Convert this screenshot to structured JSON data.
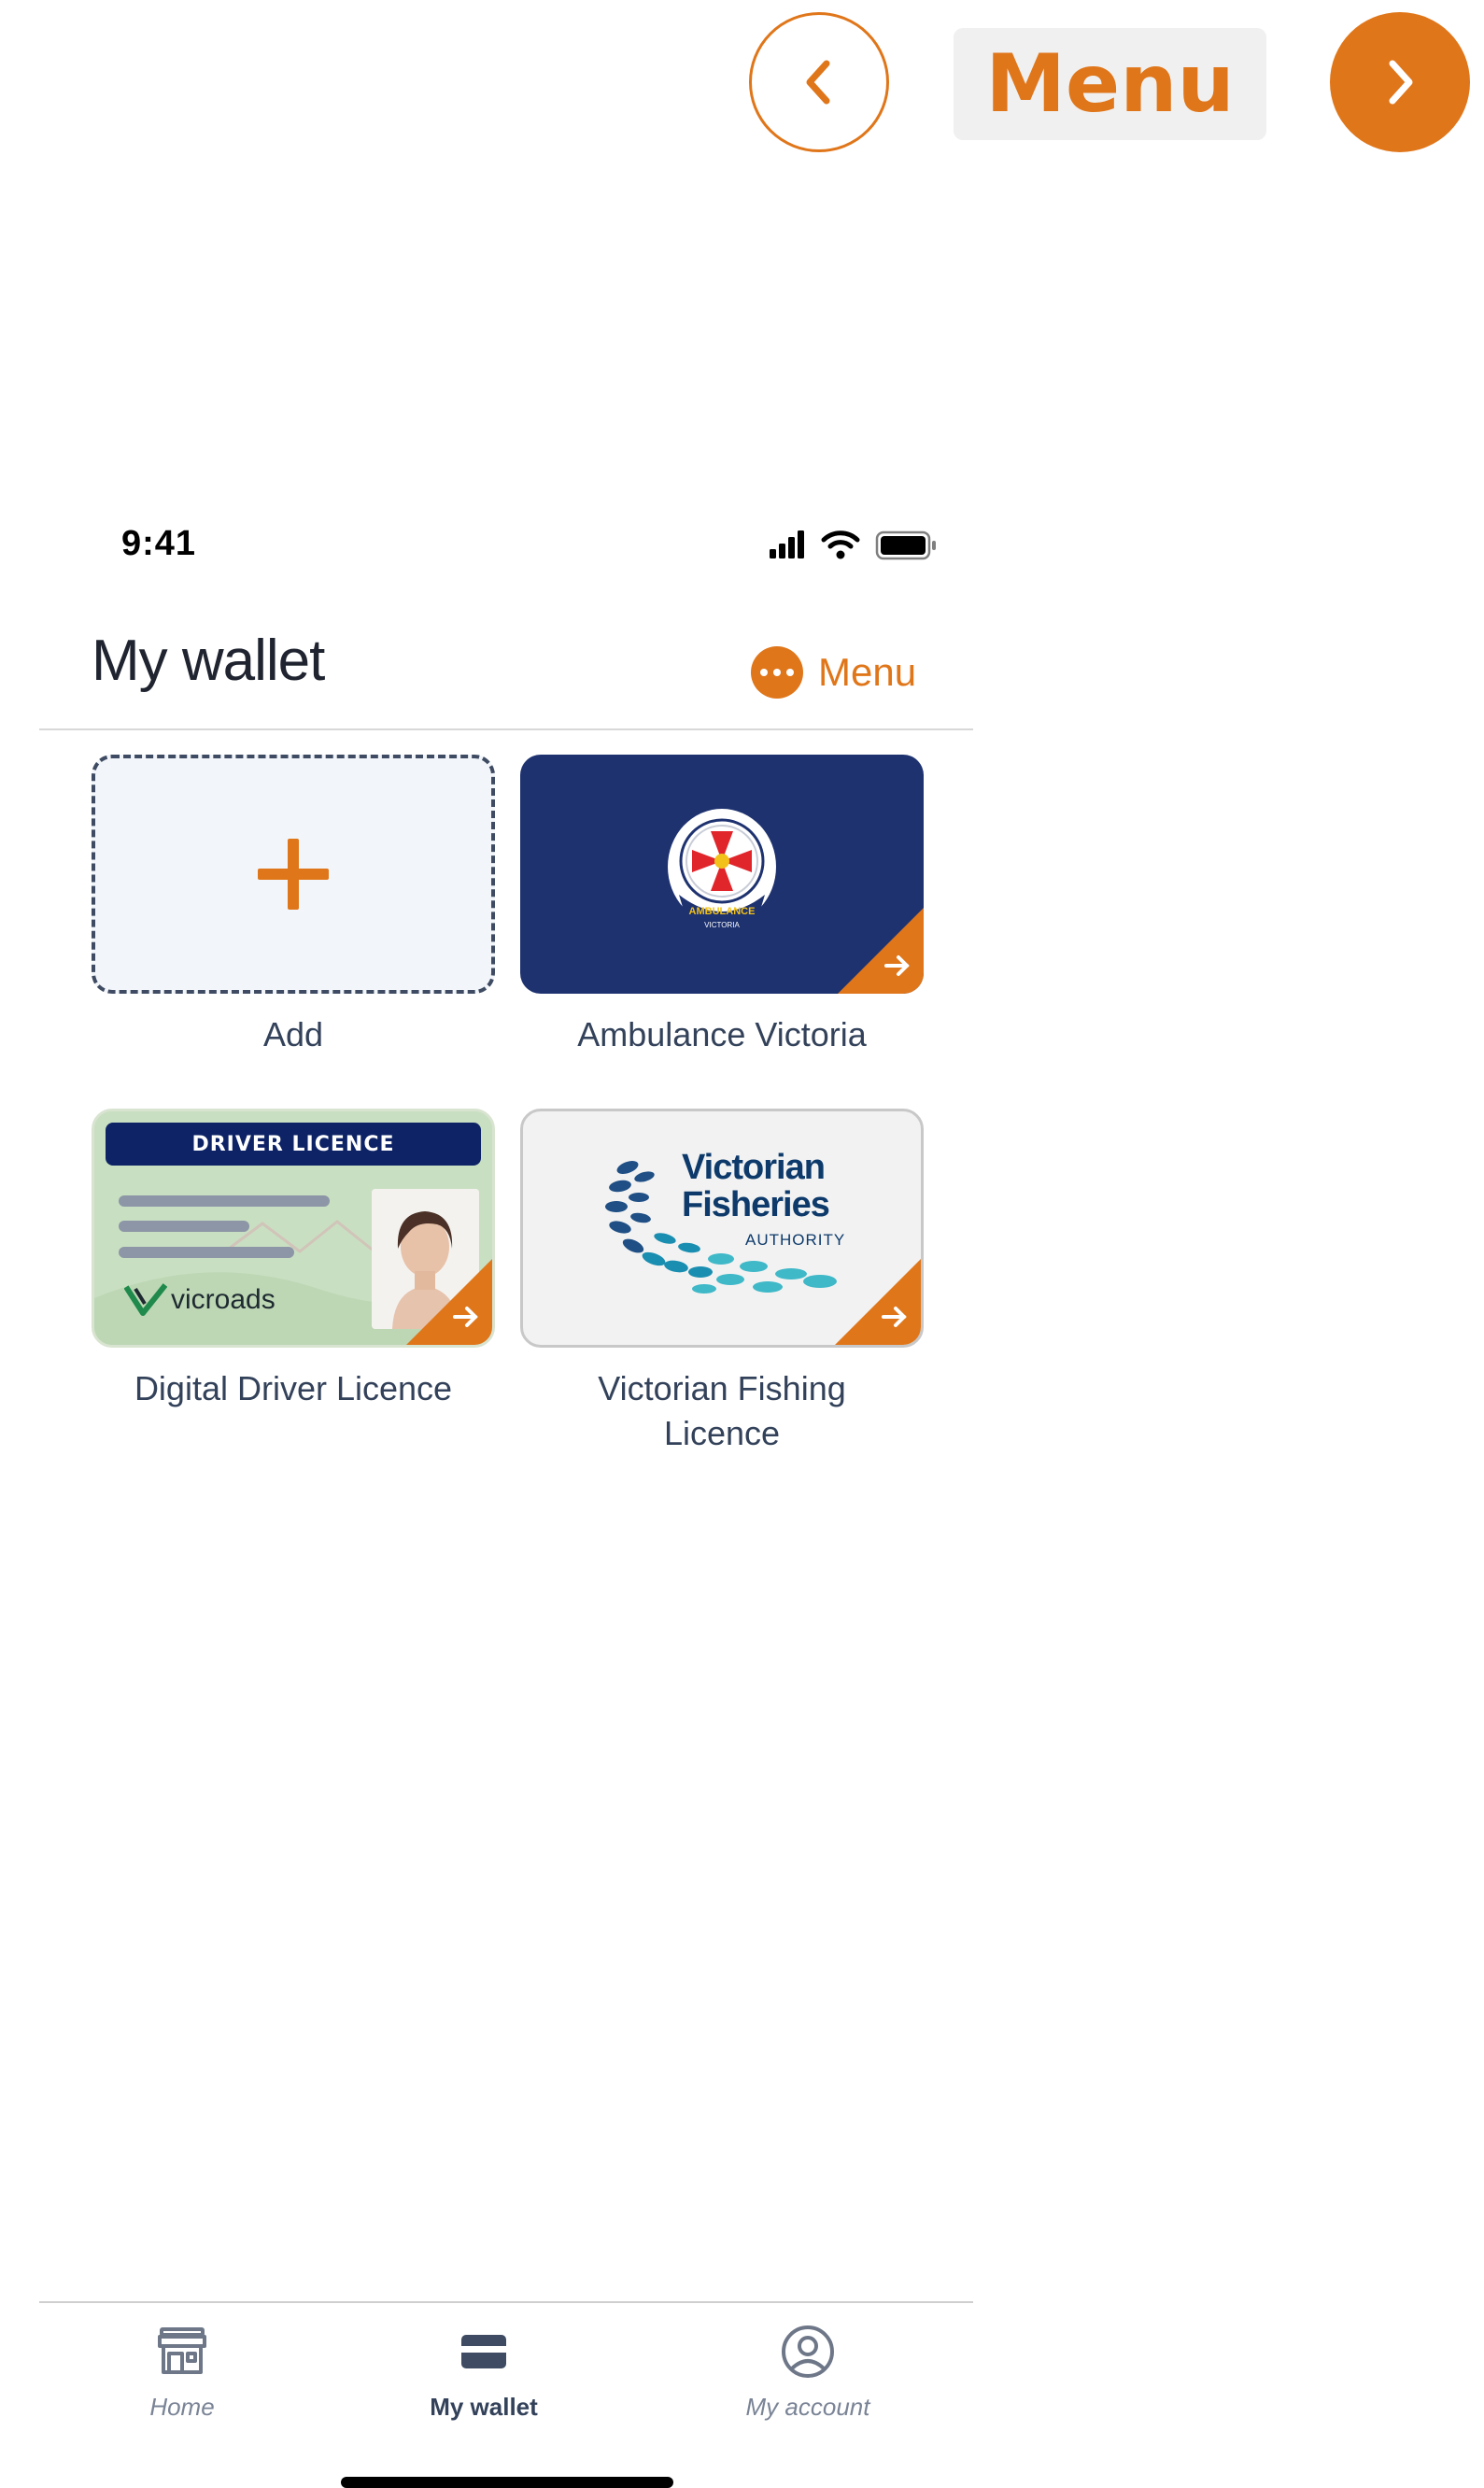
{
  "presenter": {
    "menu_label": "Menu"
  },
  "status_bar": {
    "time": "9:41"
  },
  "header": {
    "title": "My wallet",
    "menu_label": "Menu"
  },
  "cards": [
    {
      "label": "Add"
    },
    {
      "label": "Ambulance Victoria",
      "logo_text": "AMBULANCE",
      "logo_subtext": "VICTORIA"
    },
    {
      "label": "Digital Driver Licence",
      "banner": "DRIVER LICENCE",
      "brand": "vicroads"
    },
    {
      "label": "Victorian Fishing\nLicence",
      "logo_title_1": "Victorian",
      "logo_title_2": "Fisheries",
      "logo_subtitle": "AUTHORITY"
    }
  ],
  "tabs": [
    {
      "label": "Home",
      "icon": "store-icon",
      "active": false
    },
    {
      "label": "My wallet",
      "icon": "wallet-card-icon",
      "active": true
    },
    {
      "label": "My account",
      "icon": "account-circle-icon",
      "active": false
    }
  ],
  "colors": {
    "accent": "#e0761a",
    "ambulance_navy": "#1e3270",
    "text_dark": "#1f2430",
    "text_muted": "#33425a"
  }
}
